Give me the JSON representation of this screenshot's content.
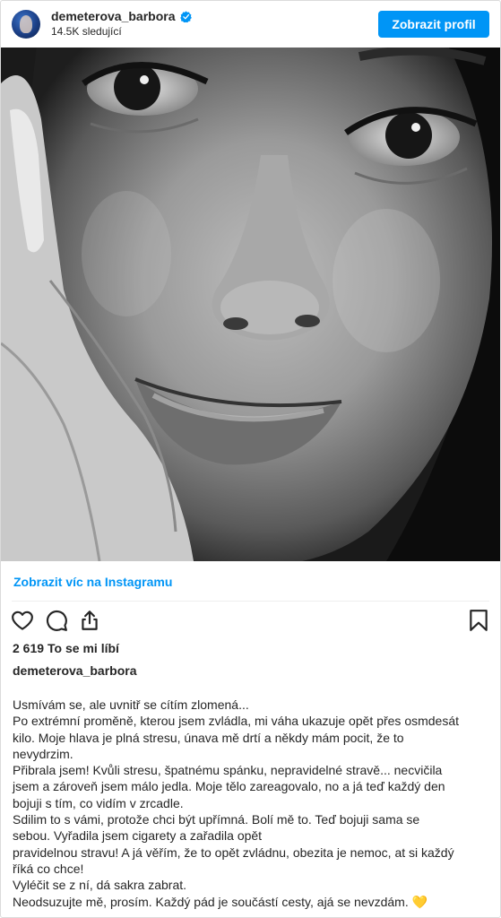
{
  "header": {
    "username": "demeterova_barbora",
    "followers": "14.5K sledující",
    "profile_button": "Zobrazit profil"
  },
  "post": {
    "more_link": "Zobrazit víc na Instagramu",
    "likes_count": "2 619",
    "likes_label": "To se mi líbí",
    "caption_username": "demeterova_barbora",
    "caption_lines": [
      "Usmívám se, ale uvnitř se cítím zlomená...",
      "Po extrémní proměně, kterou jsem zvládla, mi váha ukazuje opět přes osmdesát",
      "kilo. Moje hlava je plná stresu, únava mě drtí a někdy mám pocit, že to",
      "nevydrzim.",
      "Přibrala jsem! Kvůli stresu, špatnému spánku, nepravidelné stravě... necvičila",
      "jsem a zároveň jsem málo jedla. Moje tělo zareagovalo, no a já teď každý den",
      "bojuji s tím, co vidím v zrcadle.",
      "Sdilim to s vámi, protože chci být upřímná. Bolí mě to. Teď bojuji sama se",
      "sebou. Vyřadila jsem cigarety a zařadila opět",
      "pravidelnou stravu! A já věřím, že to opět zvládnu, obezita je nemoc, at si každý",
      "říká co chce!",
      "Vyléčit se z ní, dá sakra zabrat.",
      "Neodsuzujte mě, prosím. Každý pád je součástí cesty, ajá se nevzdám. 💛"
    ]
  },
  "icons": {
    "verified": "verified-badge-icon",
    "like": "heart-icon",
    "comment": "comment-icon",
    "share": "share-icon",
    "save": "bookmark-icon"
  },
  "colors": {
    "accent": "#0095f6",
    "text": "#262626",
    "border": "#dbdbdb"
  }
}
